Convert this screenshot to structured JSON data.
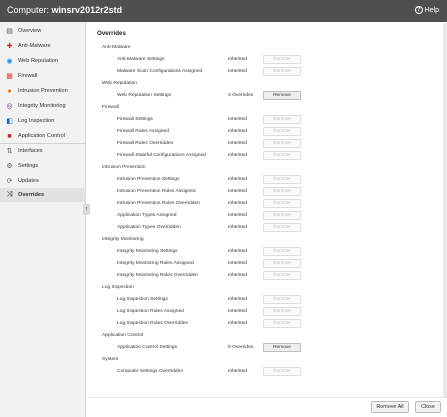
{
  "titlebar": {
    "prefix": "Computer:",
    "hostname": "winsrv2012r2std",
    "help_label": "Help"
  },
  "sidebar": {
    "items": [
      {
        "label": "Overview",
        "icon": "overview-icon",
        "color": "#555555"
      },
      {
        "label": "Anti-Malware",
        "icon": "anti-malware-icon",
        "color": "#c62828"
      },
      {
        "label": "Web Reputation",
        "icon": "web-reputation-icon",
        "color": "#1e88e5"
      },
      {
        "label": "Firewall",
        "icon": "firewall-icon",
        "color": "#e53935"
      },
      {
        "label": "Intrusion Prevention",
        "icon": "intrusion-prevention-icon",
        "color": "#ef6c00"
      },
      {
        "label": "Integrity Monitoring",
        "icon": "integrity-monitoring-icon",
        "color": "#6a1b9a"
      },
      {
        "label": "Log Inspection",
        "icon": "log-inspection-icon",
        "color": "#1565c0"
      },
      {
        "label": "Application Control",
        "icon": "application-control-icon",
        "color": "#c62828"
      },
      {
        "label": "Interfaces",
        "icon": "interfaces-icon",
        "color": "#455a64"
      },
      {
        "label": "Settings",
        "icon": "settings-icon",
        "color": "#616161"
      },
      {
        "label": "Updates",
        "icon": "updates-icon",
        "color": "#616161"
      },
      {
        "label": "Overrides",
        "icon": "overrides-icon",
        "color": "#616161",
        "active": true
      }
    ]
  },
  "main": {
    "heading": "Overrides",
    "remove_label": "Remove",
    "sections": [
      {
        "title": "Anti-Malware",
        "rows": [
          {
            "label": "Anti-Malware Settings",
            "status": "Inherited",
            "enabled": false
          },
          {
            "label": "Malware Scan Configurations Assigned",
            "status": "Inherited",
            "enabled": false
          }
        ]
      },
      {
        "title": "Web Reputation",
        "rows": [
          {
            "label": "Web Reputation Settings",
            "status": "3 Overrides",
            "enabled": true
          }
        ]
      },
      {
        "title": "Firewall",
        "rows": [
          {
            "label": "Firewall Settings",
            "status": "Inherited",
            "enabled": false
          },
          {
            "label": "Firewall Rules Assigned",
            "status": "Inherited",
            "enabled": false
          },
          {
            "label": "Firewall Rules Overridden",
            "status": "Inherited",
            "enabled": false
          },
          {
            "label": "Firewall Stateful Configurations Assigned",
            "status": "Inherited",
            "enabled": false
          }
        ]
      },
      {
        "title": "Intrusion Prevention",
        "rows": [
          {
            "label": "Intrusion Prevention Settings",
            "status": "Inherited",
            "enabled": false
          },
          {
            "label": "Intrusion Prevention Rules Assigned",
            "status": "Inherited",
            "enabled": false
          },
          {
            "label": "Intrusion Prevention Rules Overridden",
            "status": "Inherited",
            "enabled": false
          },
          {
            "label": "Application Types Assigned",
            "status": "Inherited",
            "enabled": false
          },
          {
            "label": "Application Types Overridden",
            "status": "Inherited",
            "enabled": false
          }
        ]
      },
      {
        "title": "Integrity Monitoring",
        "rows": [
          {
            "label": "Integrity Monitoring Settings",
            "status": "Inherited",
            "enabled": false
          },
          {
            "label": "Integrity Monitoring Rules Assigned",
            "status": "Inherited",
            "enabled": false
          },
          {
            "label": "Integrity Monitoring Rules Overridden",
            "status": "Inherited",
            "enabled": false
          }
        ]
      },
      {
        "title": "Log Inspection",
        "rows": [
          {
            "label": "Log Inspection Settings",
            "status": "Inherited",
            "enabled": false
          },
          {
            "label": "Log Inspection Rules Assigned",
            "status": "Inherited",
            "enabled": false
          },
          {
            "label": "Log Inspection Rules Overridden",
            "status": "Inherited",
            "enabled": false
          }
        ]
      },
      {
        "title": "Application Control",
        "rows": [
          {
            "label": "Application Control Settings",
            "status": "5 Overrides",
            "enabled": true
          }
        ]
      },
      {
        "title": "System",
        "rows": [
          {
            "label": "Computer Settings Overridden",
            "status": "Inherited",
            "enabled": false
          }
        ]
      }
    ]
  },
  "footer": {
    "remove_all_label": "Remove All",
    "close_label": "Close"
  },
  "colors": {
    "titlebar": "#4f4f4f",
    "sidebar": "#f2f2f2",
    "active_item": "#e2e2e2"
  }
}
